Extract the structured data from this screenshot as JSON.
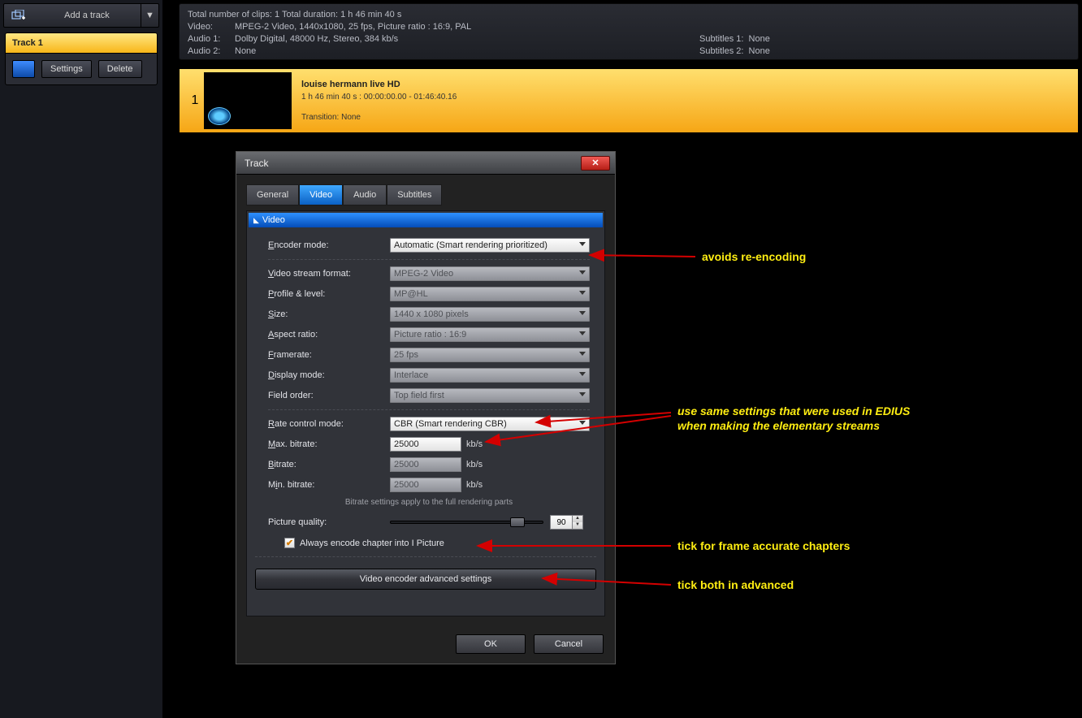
{
  "sidebar": {
    "add_track_label": "Add a track",
    "track_title": "Track 1",
    "settings_btn": "Settings",
    "delete_btn": "Delete"
  },
  "info": {
    "summary": "Total number of clips: 1    Total duration: 1 h 46 min 40 s",
    "video_label": "Video:",
    "video_val": "MPEG-2 Video,  1440x1080,  25  fps,  Picture ratio : 16:9,  PAL",
    "audio1_label": "Audio 1:",
    "audio1_val": "Dolby Digital,  48000  Hz,  Stereo,  384  kb/s",
    "audio2_label": "Audio 2:",
    "audio2_val": "None",
    "sub1_label": "Subtitles 1:",
    "sub1_val": "None",
    "sub2_label": "Subtitles 2:",
    "sub2_val": "None"
  },
  "clip": {
    "number": "1",
    "title": "louise hermann live HD",
    "time": "1 h 46 min 40 s :  00:00:00.00 - 01:46:40.16",
    "transition": "Transition: None"
  },
  "dialog": {
    "title": "Track",
    "tabs": {
      "general": "General",
      "video": "Video",
      "audio": "Audio",
      "subtitles": "Subtitles"
    },
    "section_header": "Video",
    "encoder_mode_label": "Encoder mode:",
    "encoder_mode_value": "Automatic (Smart rendering prioritized)",
    "stream_format_label": "Video stream format:",
    "stream_format_value": "MPEG-2 Video",
    "profile_label": "Profile & level:",
    "profile_value": "MP@HL",
    "size_label": "Size:",
    "size_value": "1440 x 1080 pixels",
    "aspect_label": "Aspect ratio:",
    "aspect_value": "Picture ratio : 16:9",
    "framerate_label": "Framerate:",
    "framerate_value": "25  fps",
    "display_label": "Display mode:",
    "display_value": "Interlace",
    "field_order_label": "Field order:",
    "field_order_value": "Top field first",
    "rate_control_label": "Rate control mode:",
    "rate_control_value": "CBR (Smart rendering CBR)",
    "max_bitrate_label": "Max. bitrate:",
    "max_bitrate_value": "25000",
    "bitrate_label": "Bitrate:",
    "bitrate_value": "25000",
    "min_bitrate_label": "Min. bitrate:",
    "min_bitrate_value": "25000",
    "unit": "kb/s",
    "bitrate_note": "Bitrate settings apply to the full rendering parts",
    "picture_quality_label": "Picture quality:",
    "picture_quality_value": "90",
    "ipicture_checkbox": "Always encode chapter into I Picture",
    "advanced_btn": "Video encoder advanced settings",
    "ok": "OK",
    "cancel": "Cancel"
  },
  "annotations": {
    "avoid": "avoids re-encoding",
    "edius1": "use same settings that were used in EDIUS",
    "edius2": "when making the elementary streams",
    "chapters": "tick for frame accurate chapters",
    "advanced": "tick both in advanced"
  }
}
